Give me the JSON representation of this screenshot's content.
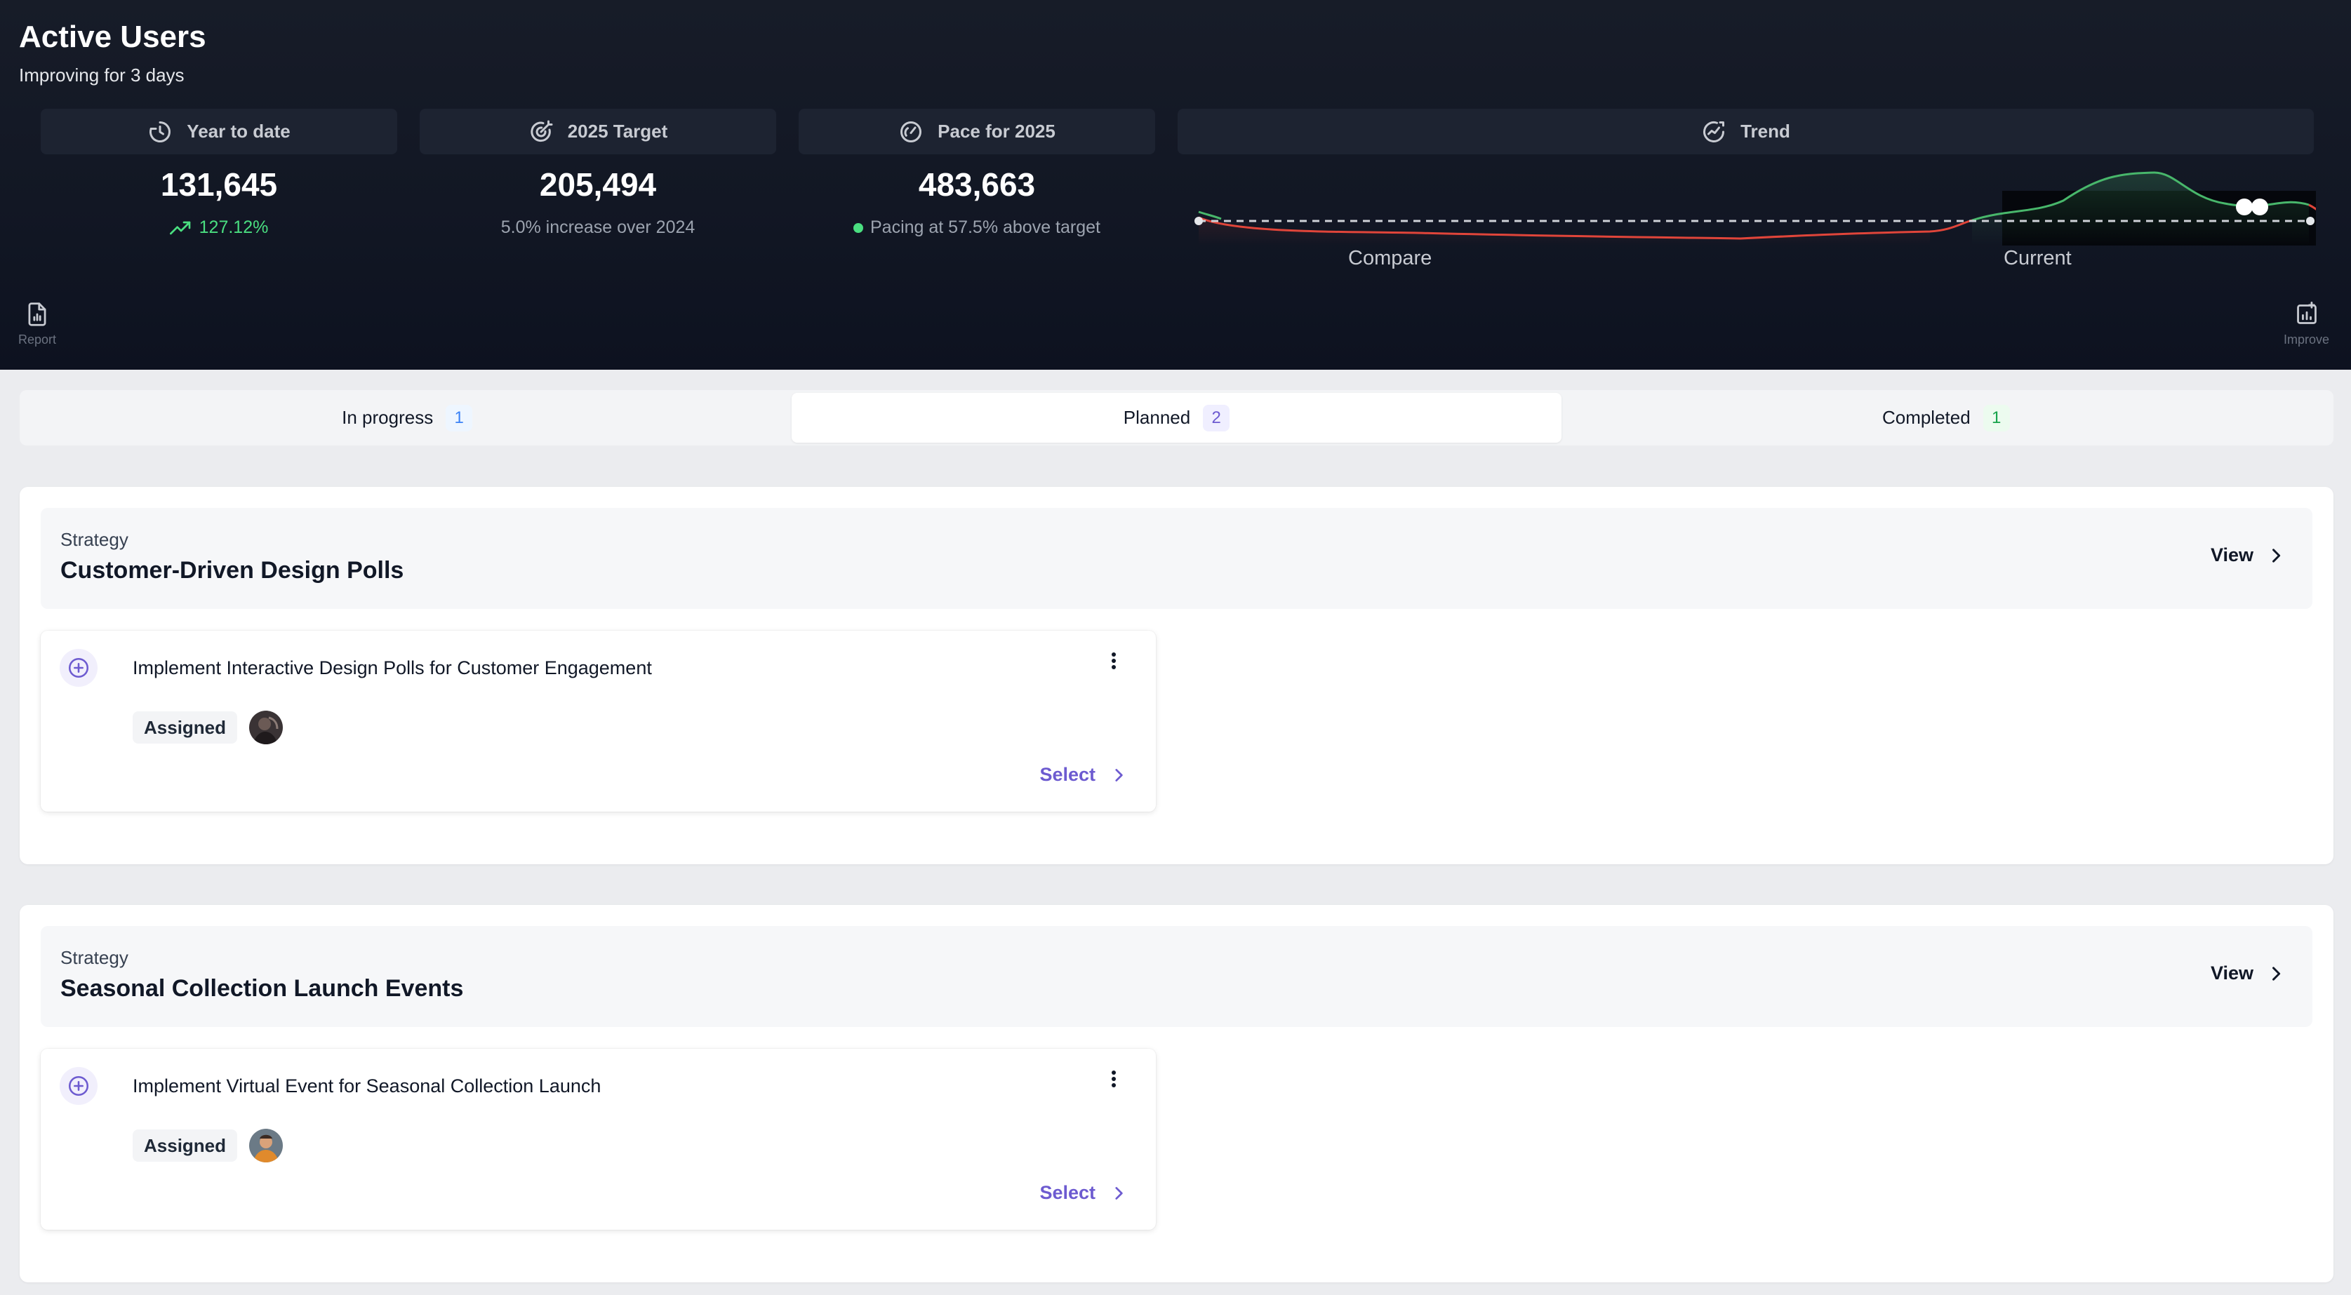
{
  "header": {
    "title": "Active Users",
    "subtitle": "Improving for 3 days"
  },
  "stats": [
    {
      "label": "Year to date",
      "icon": "clock-icon",
      "value": "131,645",
      "sub": "127.12%",
      "sub_icon": "trending-up-icon"
    },
    {
      "label": "2025 Target",
      "icon": "target-icon",
      "value": "205,494",
      "sub": "5.0% increase over 2024"
    },
    {
      "label": "Pace for 2025",
      "icon": "gauge-icon",
      "value": "483,663",
      "sub": "Pacing at 57.5% above target"
    }
  ],
  "trend": {
    "label": "Trend",
    "icon": "trend-chart-icon",
    "compare_label": "Compare",
    "current_label": "Current",
    "colors": {
      "up": "#48b76b",
      "down": "#e0453a",
      "baseline": "#cfd2d8"
    }
  },
  "actions": {
    "report_label": "Report",
    "improve_label": "Improve"
  },
  "tabs": [
    {
      "label": "In progress",
      "count": "1"
    },
    {
      "label": "Planned",
      "count": "2"
    },
    {
      "label": "Completed",
      "count": "1"
    }
  ],
  "strategies": [
    {
      "kicker": "Strategy",
      "title": "Customer-Driven Design Polls",
      "view_label": "View",
      "task": {
        "title": "Implement Interactive Design Polls for Customer Engagement",
        "status": "Assigned",
        "select_label": "Select"
      }
    },
    {
      "kicker": "Strategy",
      "title": "Seasonal Collection Launch Events",
      "view_label": "View",
      "task": {
        "title": "Implement Virtual Event for Seasonal Collection Launch",
        "status": "Assigned",
        "select_label": "Select"
      }
    }
  ],
  "colors": {
    "accent": "#6d5bd0",
    "positive": "#4ade80",
    "header_bg": "#121724"
  }
}
